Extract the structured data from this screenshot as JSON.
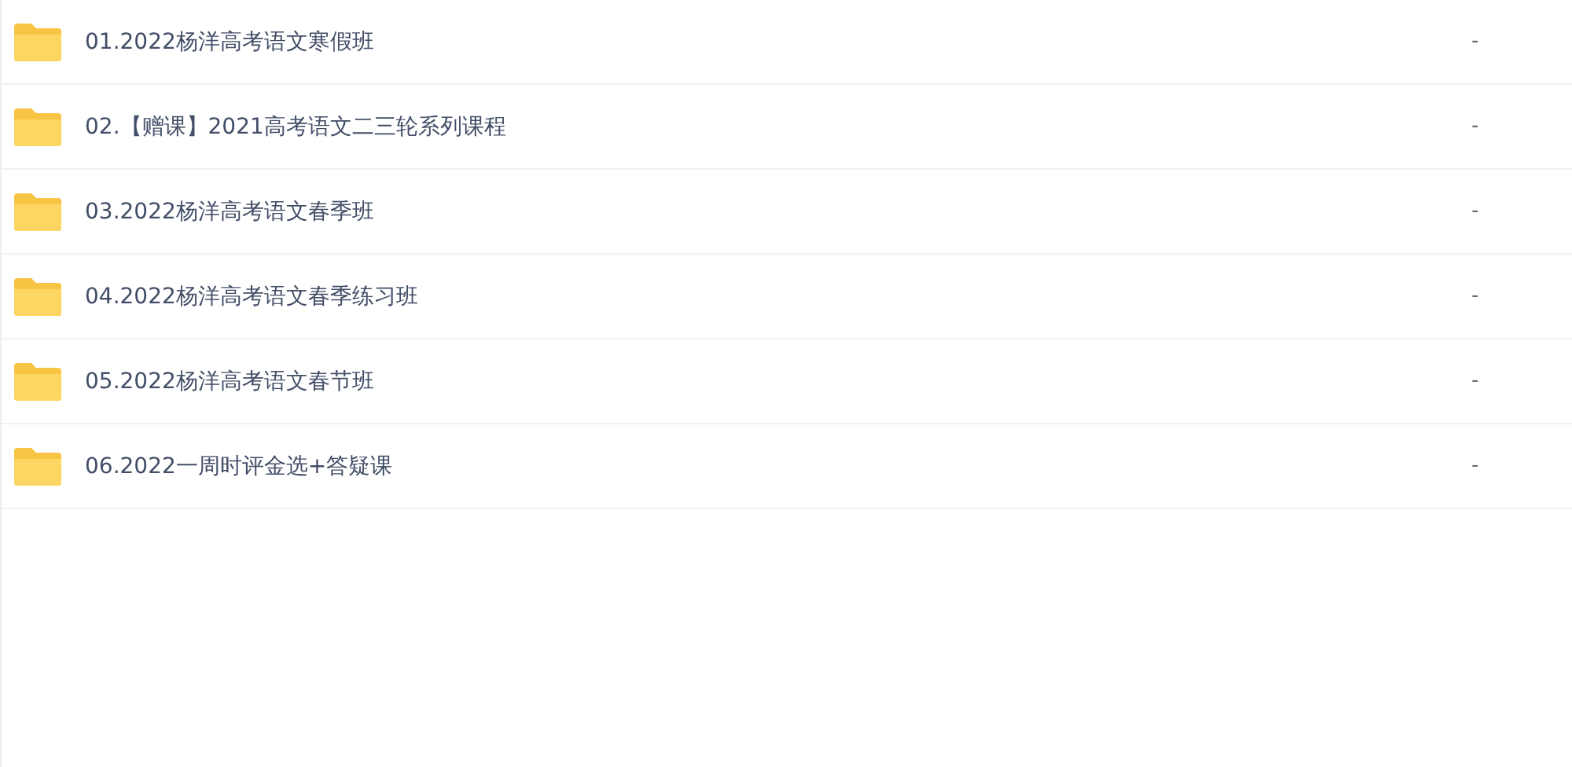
{
  "files": [
    {
      "name": "01.2022杨洋高考语文寒假班",
      "size": "-"
    },
    {
      "name": "02.【赠课】2021高考语文二三轮系列课程",
      "size": "-"
    },
    {
      "name": "03.2022杨洋高考语文春季班",
      "size": "-"
    },
    {
      "name": "04.2022杨洋高考语文春季练习班",
      "size": "-"
    },
    {
      "name": "05.2022杨洋高考语文春节班",
      "size": "-"
    },
    {
      "name": "06.2022一周时评金选+答疑课",
      "size": "-"
    }
  ]
}
